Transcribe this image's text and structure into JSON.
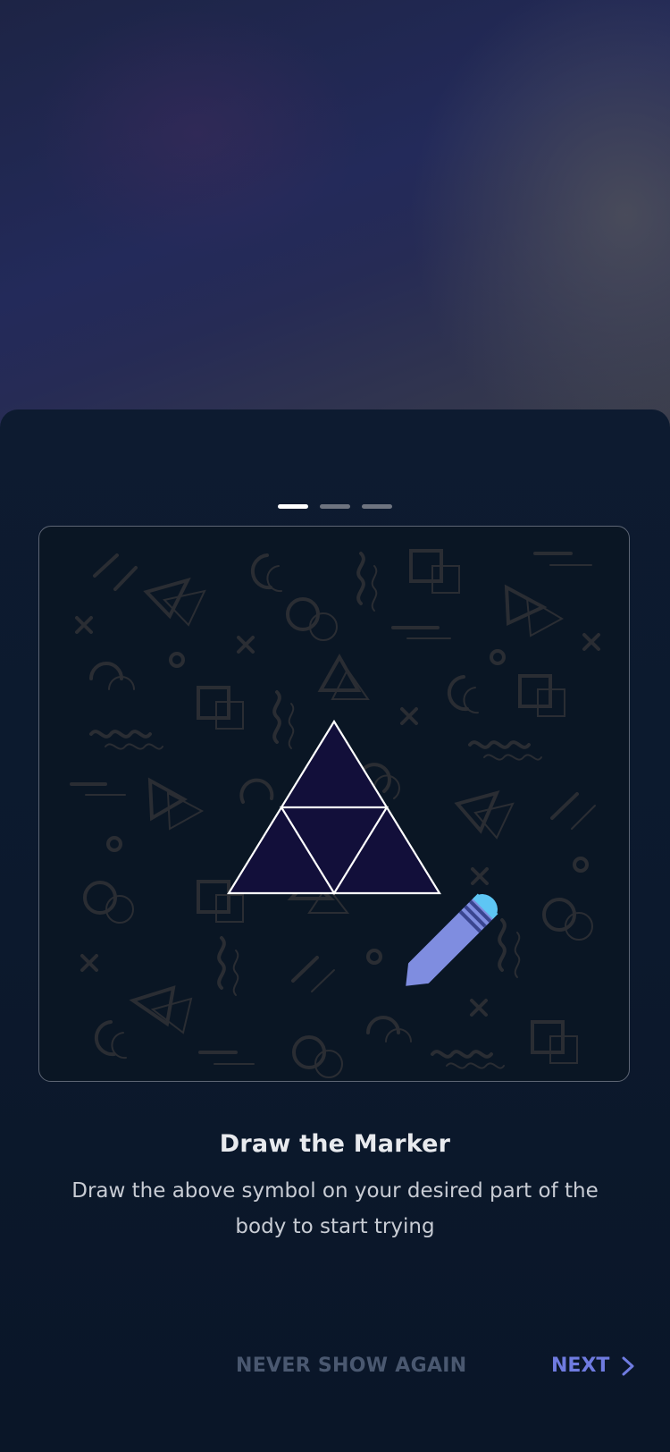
{
  "pager": {
    "pages": 3,
    "active_index": 0
  },
  "marker": {
    "title": "Draw the Marker",
    "description": "Draw the above symbol on your desired part of the body to start trying"
  },
  "footer": {
    "never_show_label": "NEVER SHOW AGAIN",
    "next_label": "NEXT"
  },
  "icons": {
    "marker_symbol": "triforce-triangle-icon",
    "pen": "marker-pen-icon",
    "next": "chevron-right-icon"
  },
  "colors": {
    "accent": "#6f7be0",
    "pen_body": "#7f8de0",
    "pen_cap": "#5ec6f4",
    "triangle_fill": "#120f3a",
    "muted_text": "#4a5870"
  }
}
